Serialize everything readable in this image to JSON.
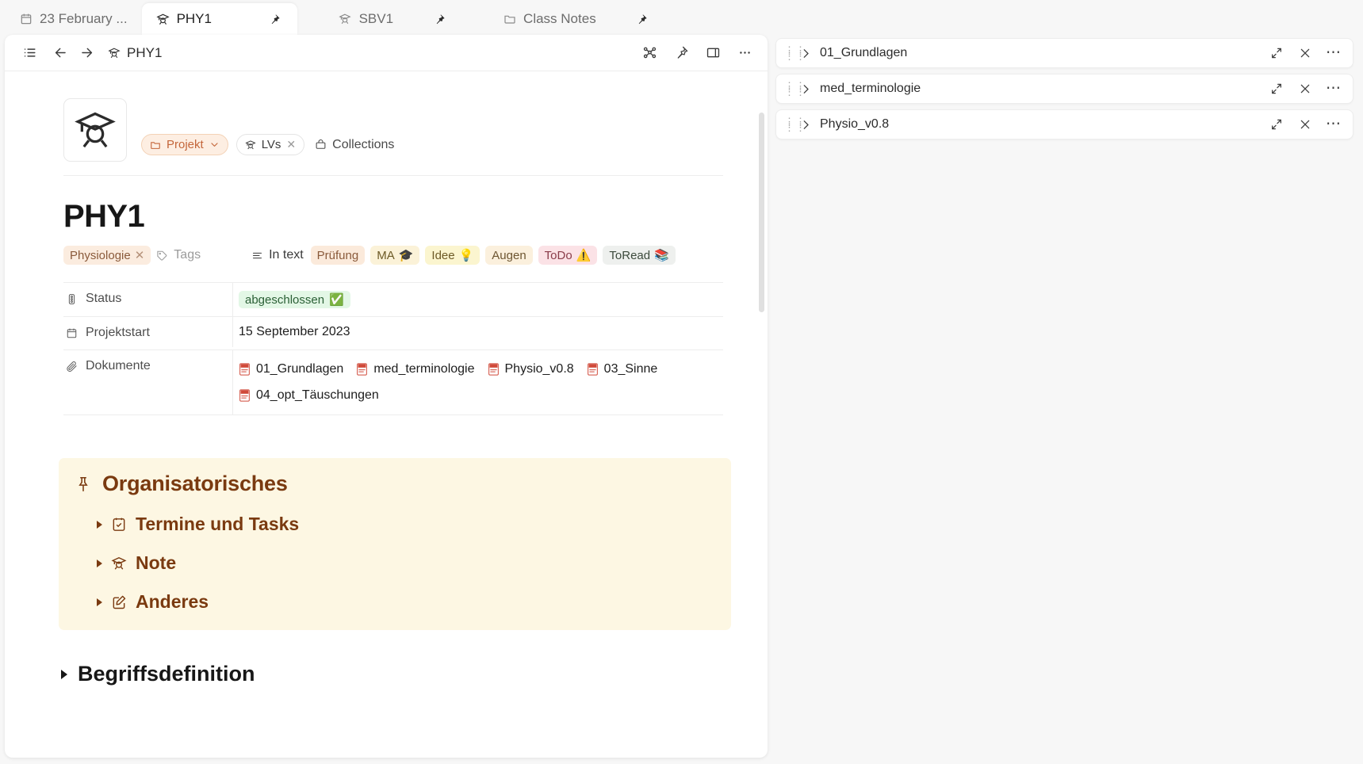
{
  "tabs": [
    {
      "label": "23 February ...",
      "icon": "calendar-icon",
      "active": false,
      "pinned": false
    },
    {
      "label": "PHY1",
      "icon": "graduation-cap-icon",
      "active": true,
      "pinned": true
    },
    {
      "label": "SBV1",
      "icon": "graduation-cap-icon",
      "active": false,
      "pinned": true
    },
    {
      "label": "Class Notes",
      "icon": "folder-icon",
      "active": false,
      "pinned": true
    }
  ],
  "note_header": {
    "title": "PHY1",
    "icon": "graduation-cap-icon",
    "buttons": {
      "menu": "list-menu-icon",
      "back": "arrow-left-icon",
      "forward": "arrow-right-icon",
      "graph": "graph-view-icon",
      "pin": "pin-icon",
      "split": "split-pane-icon",
      "more": "more-horizontal-icon"
    }
  },
  "note": {
    "banner_icon": "graduation-cap-icon",
    "chips": [
      {
        "label": "Projekt",
        "icon": "folder-icon",
        "style": "projekt",
        "trailing": "chevron-down-icon"
      },
      {
        "label": "LVs",
        "icon": "graduation-cap-icon",
        "style": "lvs",
        "trailing": "close-icon"
      },
      {
        "label": "Collections",
        "icon": "collections-icon",
        "style": "plain",
        "trailing": ""
      }
    ],
    "title": "PHY1",
    "tags_left": [
      {
        "label": "Physiologie",
        "emoji": "",
        "bg": "#fbecdf",
        "fg": "#8a5a3b",
        "removable": true
      }
    ],
    "tags_placeholder": "Tags",
    "in_text_label": "In text",
    "tags_right": [
      {
        "label": "Prüfung",
        "emoji": "",
        "bg": "#fbeadb",
        "fg": "#8a5a3b"
      },
      {
        "label": "MA",
        "emoji": "🎓",
        "bg": "#fbf2d8",
        "fg": "#6d5a26"
      },
      {
        "label": "Idee",
        "emoji": "💡",
        "bg": "#fbf5cf",
        "fg": "#6d5a26"
      },
      {
        "label": "Augen",
        "emoji": "",
        "bg": "#fbf0dd",
        "fg": "#6d5531"
      },
      {
        "label": "ToDo",
        "emoji": "⚠️",
        "bg": "#fbe2e6",
        "fg": "#8a3c4a"
      },
      {
        "label": "ToRead",
        "emoji": "📚",
        "bg": "#eef0ee",
        "fg": "#3c4a3c"
      }
    ],
    "properties": [
      {
        "key": "Status",
        "icon": "status-icon",
        "type": "badge",
        "badge": {
          "text": "abgeschlossen",
          "emoji": "✅",
          "bg": "#e3f7e6",
          "fg": "#2a5f35"
        }
      },
      {
        "key": "Projektstart",
        "icon": "calendar-icon",
        "type": "text",
        "value": "15 September 2023"
      },
      {
        "key": "Dokumente",
        "icon": "paperclip-icon",
        "type": "links",
        "links": [
          "01_Grundlagen",
          "med_terminologie",
          "Physio_v0.8",
          "03_Sinne",
          "04_opt_Täuschungen"
        ]
      }
    ],
    "callout": {
      "icon": "pin-icon",
      "title": "Organisatorisches",
      "bg": "#fdf7e3",
      "fg": "#7a3a10",
      "items": [
        {
          "label": "Termine und Tasks",
          "icon": "calendar-check-icon"
        },
        {
          "label": "Note",
          "icon": "graduation-cap-icon"
        },
        {
          "label": "Anderes",
          "icon": "edit-note-icon"
        }
      ]
    },
    "section": {
      "label": "Begriffsdefinition"
    }
  },
  "right_pane": {
    "rows": [
      {
        "label": "01_Grundlagen"
      },
      {
        "label": "med_terminologie"
      },
      {
        "label": "Physio_v0.8"
      }
    ],
    "row_actions": {
      "grip": "drag-handle-icon",
      "expand": "chevron-right-icon",
      "maximize": "expand-diagonal-icon",
      "close": "close-icon",
      "more": "more-horizontal-icon"
    }
  },
  "colors": {
    "accent": "#c4663a",
    "callout_bg": "#fdf7e3",
    "callout_fg": "#7a3a10",
    "status_green": "#2a5f35"
  }
}
